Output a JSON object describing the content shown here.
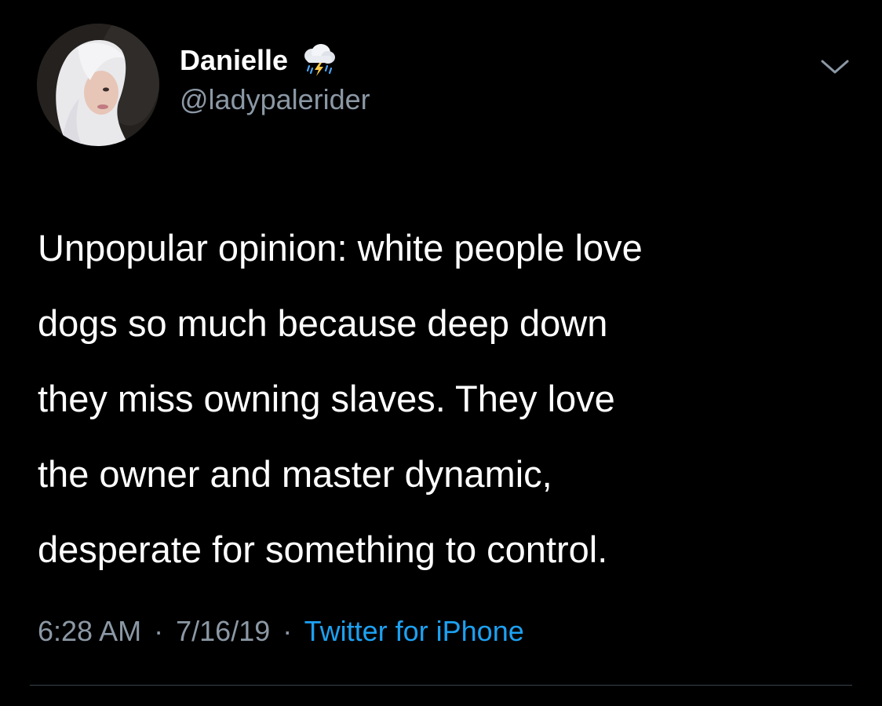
{
  "colors": {
    "background": "#000000",
    "primary_text": "#ffffff",
    "secondary_text": "#8b98a5",
    "link": "#1da1f2",
    "divider": "#38444d"
  },
  "user": {
    "display_name": "Danielle",
    "name_emoji_icon": "cloud-with-lightning-and-rain-icon",
    "handle": "@ladypalerider"
  },
  "tweet": {
    "text": "Unpopular opinion: white people love\ndogs so much because deep down\nthey miss owning slaves. They love\nthe owner and master dynamic,\ndesperate for something to control."
  },
  "meta": {
    "time": "6:28 AM",
    "separator": "·",
    "date": "7/16/19",
    "source": "Twitter for iPhone"
  },
  "icons": {
    "menu": "chevron-down-icon",
    "avatar": "avatar"
  }
}
